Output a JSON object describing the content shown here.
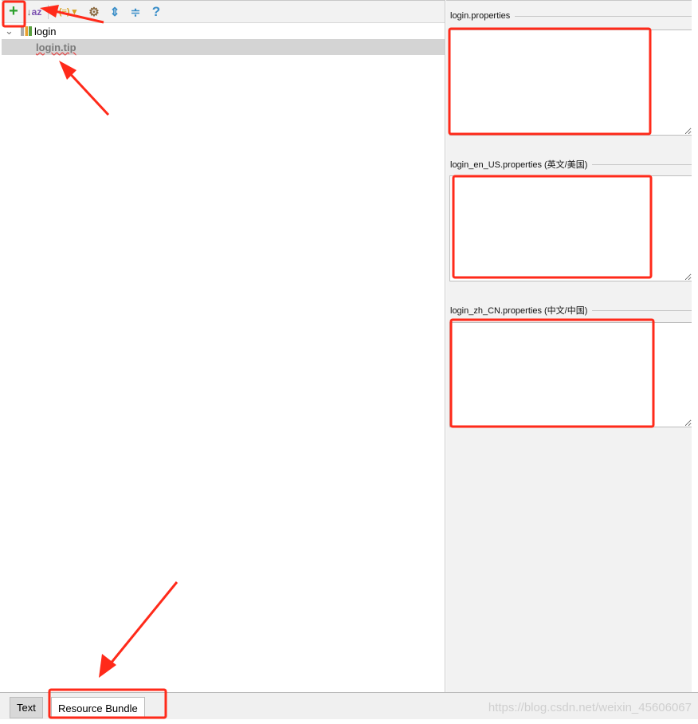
{
  "toolbar": {
    "buttons": [
      {
        "name": "add-icon",
        "glyph": "+",
        "color": "#2ca02c"
      },
      {
        "name": "sort-alpha-icon",
        "glyph": "↓a z",
        "color": "#7a4fb0"
      },
      {
        "name": "group-icon",
        "glyph": "(≡)",
        "color": "#d8a020"
      },
      {
        "name": "settings-icon",
        "glyph": "⚙",
        "color": "#8a8a8a"
      },
      {
        "name": "expand-all-icon",
        "glyph": "⇕",
        "color": "#3a8ec8"
      },
      {
        "name": "collapse-all-icon",
        "glyph": "≑",
        "color": "#3a8ec8"
      },
      {
        "name": "help-icon",
        "glyph": "?",
        "color": "#3a8ec8"
      }
    ]
  },
  "tree": {
    "root": "login",
    "child": "login.tip"
  },
  "sections": [
    {
      "title": "login.properties",
      "value": ""
    },
    {
      "title": "login_en_US.properties (英文/美国)",
      "value": ""
    },
    {
      "title": "login_zh_CN.properties (中文/中国)",
      "value": ""
    }
  ],
  "tabs": [
    {
      "label": "Text",
      "active": false
    },
    {
      "label": "Resource Bundle",
      "active": true
    }
  ],
  "watermark": "https://blog.csdn.net/weixin_45606067",
  "colors": {
    "annotation": "#ff2a1a",
    "selection": "#d4d4d4"
  }
}
